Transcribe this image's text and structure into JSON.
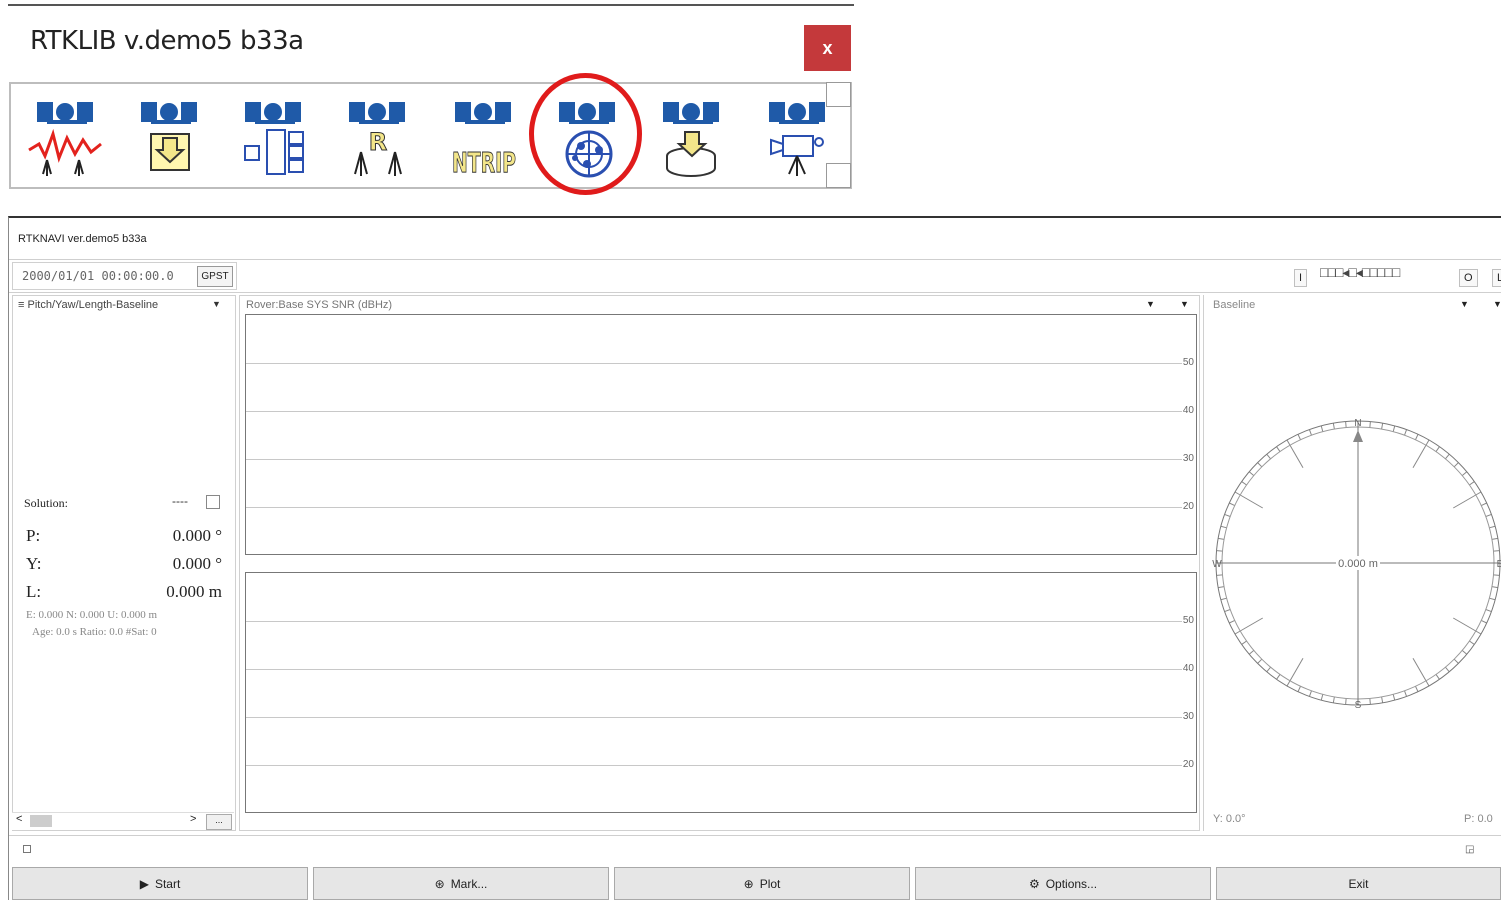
{
  "launcher": {
    "title": "RTKLIB v.demo5 b33a",
    "close_label": "x",
    "tools": [
      {
        "name": "rtkplot-icon",
        "overlay": ""
      },
      {
        "name": "rtkconv-icon",
        "overlay": ""
      },
      {
        "name": "strsvr-icon",
        "overlay": ""
      },
      {
        "name": "rtkpost-icon",
        "overlay": "R"
      },
      {
        "name": "ntrip-browser-icon",
        "overlay": "NTRIP"
      },
      {
        "name": "rtknavi-icon",
        "overlay": ""
      },
      {
        "name": "rtkget-icon",
        "overlay": ""
      },
      {
        "name": "rtkvideo-icon",
        "overlay": ""
      }
    ],
    "highlight_color": "#e01b1b"
  },
  "navi": {
    "title": "RTKNAVI ver.demo5 b33a",
    "time": "2000/01/01 00:00:00.0",
    "time_system": "GPST",
    "toolbar_right": {
      "btn1": "I",
      "boxes": "□□□◂□◂□□□□□",
      "btn_o": "O",
      "btn_l": "L"
    },
    "left_panel": {
      "header": "Pitch/Yaw/Length-Baseline",
      "solution_label": "Solution:",
      "solution_status": "----",
      "p_label": "P:",
      "p_value": "0.000 °",
      "y_label": "Y:",
      "y_value": "0.000 °",
      "l_label": "L:",
      "l_value": "0.000 m",
      "enu": "E: 0.000 N: 0.000 U: 0.000 m",
      "age": "Age: 0.0 s Ratio: 0.0 #Sat: 0",
      "more_label": "..."
    },
    "center_panel": {
      "header": "Rover:Base SYS SNR (dBHz)",
      "yticks": [
        "50",
        "40",
        "30",
        "20"
      ]
    },
    "right_panel": {
      "header": "Baseline",
      "center_value": "0.000 m",
      "n": "N",
      "s": "S",
      "w": "W",
      "e": "E",
      "y_readout": "Y: 0.0°",
      "p_readout": "P: 0.0"
    },
    "buttons": {
      "start": "Start",
      "mark": "Mark...",
      "plot": "Plot",
      "options": "Options...",
      "exit": "Exit"
    }
  }
}
